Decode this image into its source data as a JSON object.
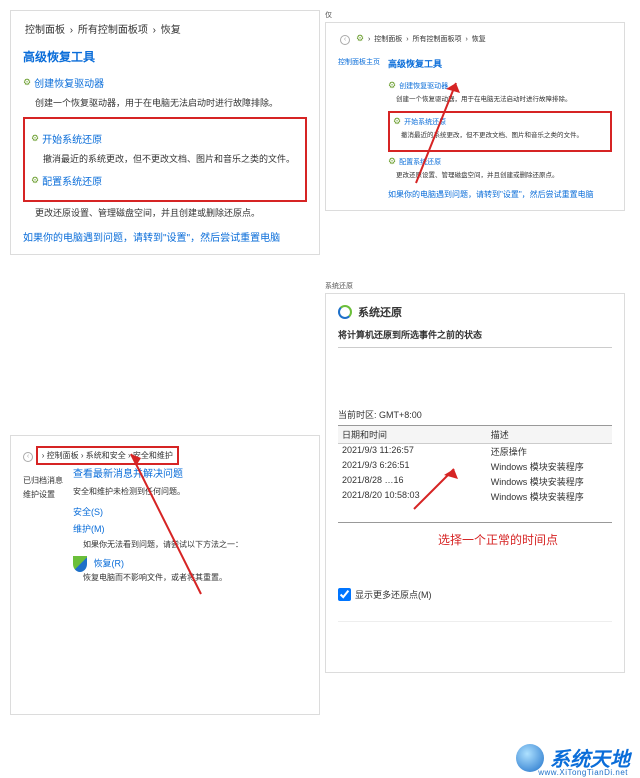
{
  "panel1": {
    "breadcrumb": [
      "控制面板",
      "所有控制面板项",
      "恢复"
    ],
    "title": "高级恢复工具",
    "links": [
      {
        "heading": "创建恢复驱动器",
        "desc": "创建一个恢复驱动器，用于在电脑无法启动时进行故障排除。"
      },
      {
        "heading": "开始系统还原",
        "desc": "撤消最近的系统更改，但不更改文档、图片和音乐之类的文件。"
      },
      {
        "heading": "配置系统还原",
        "desc": "更改还原设置、管理磁盘空间，并且创建或删除还原点。"
      }
    ],
    "note": "如果你的电脑遇到问题，请转到\"设置\"，然后尝试重置电脑"
  },
  "panel2": {
    "nav_label": "仅",
    "breadcrumb": [
      "控制面板",
      "所有控制面板项",
      "恢复"
    ],
    "side_label": "控制面板主页",
    "title": "高级恢复工具",
    "links": [
      {
        "heading": "创建恢复驱动器",
        "desc": "创建一个恢复驱动器，用于在电脑无法启动时进行故障排除。"
      },
      {
        "heading": "开始系统还原",
        "desc": "撤消最近的系统更改，但不更改文档、图片和音乐之类的文件。"
      },
      {
        "heading": "配置系统还原",
        "desc": "更改还原设置、管理磁盘空间，并且创建或删除还原点。"
      }
    ],
    "note": "如果你的电脑遇到问题，请转到\"设置\"，然后尝试重置电脑"
  },
  "panel3": {
    "breadcrumb": [
      "控制面板",
      "系统和安全",
      "安全和维护"
    ],
    "sidebar": [
      "已归档消息",
      "维护设置"
    ],
    "main_title": "查看最新消息并解决问题",
    "main_desc": "安全和维护未检测到任何问题。",
    "security": "安全(S)",
    "maintenance": "维护(M)",
    "subnote": "如果你无法看到问题，请尝试以下方法之一：",
    "recovery_link": "恢复(R)",
    "recovery_desc": "恢复电脑而不影响文件，或者将其重置。"
  },
  "panel4": {
    "nav_label": "系统还原",
    "title": "系统还原",
    "subtitle": "将计算机还原到所选事件之前的状态",
    "timezone_label": "当前时区: GMT+8:00",
    "columns": [
      "日期和时间",
      "描述"
    ],
    "rows": [
      {
        "dt": "2021/9/3 11:26:57",
        "desc": "还原操作"
      },
      {
        "dt": "2021/9/3 6:26:51",
        "desc": "Windows 模块安装程序"
      },
      {
        "dt": "2021/8/28 …16",
        "desc": "Windows 模块安装程序"
      },
      {
        "dt": "2021/8/20 10:58:03",
        "desc": "Windows 模块安装程序"
      }
    ],
    "annotation": "选择一个正常的时间点",
    "checkbox": "显示更多还原点(M)"
  },
  "watermark": {
    "text": "系统天地",
    "url": "www.XiTongTianDi.net"
  }
}
